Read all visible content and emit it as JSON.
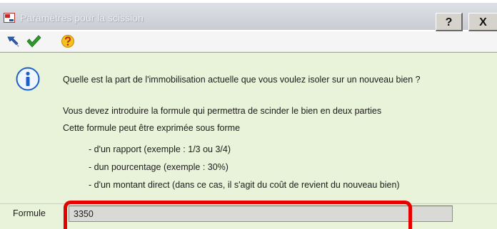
{
  "window": {
    "title": "Paramètres pour la scission",
    "help_button": "?",
    "close_button": "X",
    "app_icon": "app-icon"
  },
  "toolbar": {
    "items": [
      {
        "icon": "arrow-icon"
      },
      {
        "icon": "checkmark-icon"
      },
      {
        "icon": "help-icon"
      }
    ]
  },
  "content": {
    "icon": "info-icon",
    "question": "Quelle est la part de l'immobilisation actuelle que vous voulez isoler sur un nouveau bien ?",
    "instruction_1": "Vous devez introduire la formule qui permettra de scinder le bien en deux parties",
    "instruction_2": "Cette formule peut être exprimée sous forme",
    "options": [
      "- d'un rapport (exemple : 1/3 ou 3/4)",
      "- dun pourcentage (exemple : 30%)",
      "- d'un montant direct (dans ce cas, il s'agit du coût de revient du nouveau bien)"
    ]
  },
  "form": {
    "label": "Formule",
    "value": "3350"
  },
  "colors": {
    "content_background": "#e9f3da",
    "highlight": "#e60000",
    "input_background": "#d9d9d6"
  }
}
